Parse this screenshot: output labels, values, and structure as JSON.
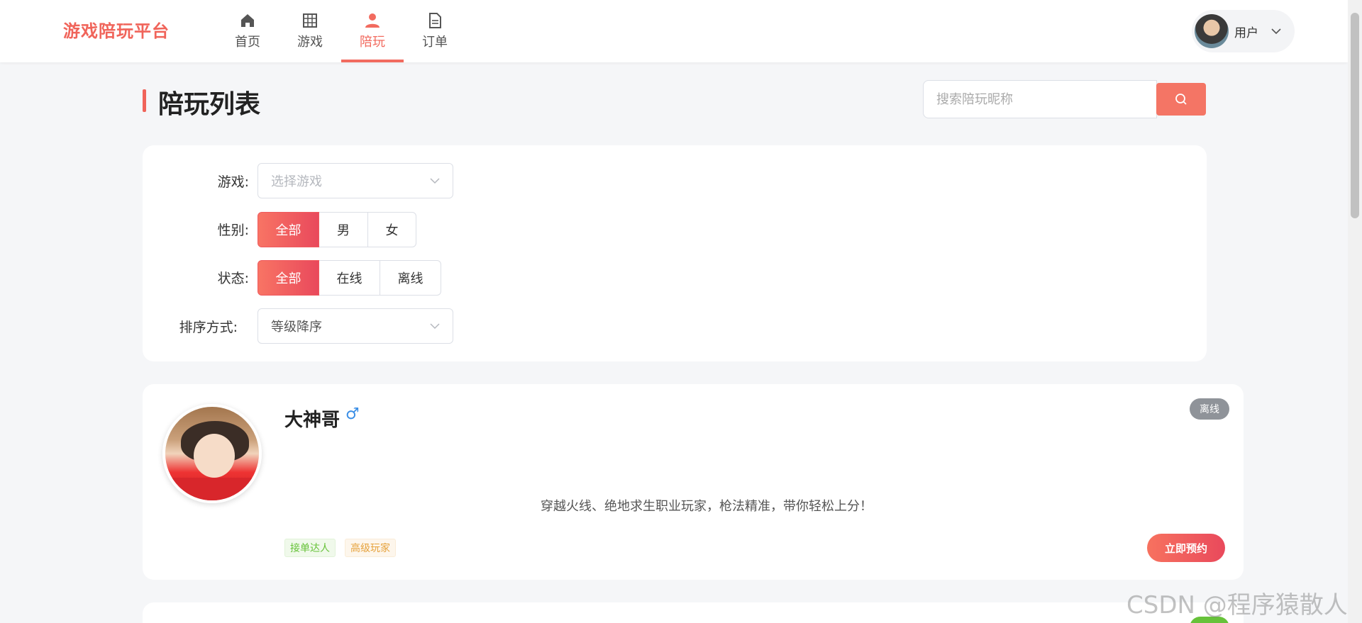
{
  "header": {
    "logo": "游戏陪玩平台",
    "nav": [
      {
        "label": "首页",
        "icon": "home-icon"
      },
      {
        "label": "游戏",
        "icon": "grid-icon"
      },
      {
        "label": "陪玩",
        "icon": "person-icon",
        "active": true
      },
      {
        "label": "订单",
        "icon": "document-icon"
      }
    ],
    "user": {
      "name": "用户"
    }
  },
  "page": {
    "title": "陪玩列表",
    "search_placeholder": "搜索陪玩昵称"
  },
  "filters": {
    "game": {
      "label": "游戏:",
      "placeholder": "选择游戏"
    },
    "gender": {
      "label": "性别:",
      "options": [
        "全部",
        "男",
        "女"
      ],
      "selected": "全部"
    },
    "status": {
      "label": "状态:",
      "options": [
        "全部",
        "在线",
        "离线"
      ],
      "selected": "全部"
    },
    "sort": {
      "label": "排序方式:",
      "value": "等级降序"
    }
  },
  "players": [
    {
      "name": "大神哥",
      "gender_symbol": "♂",
      "status": "离线",
      "description": "穿越火线、绝地求生职业玩家，枪法精准，带你轻松上分！",
      "tags": [
        "接单达人",
        "高级玩家"
      ],
      "book_label": "立即预约"
    }
  ],
  "watermark": "CSDN @程序猿散人",
  "colors": {
    "accent": "#f26b5f",
    "offline": "#8f9399",
    "online": "#67c23a"
  }
}
